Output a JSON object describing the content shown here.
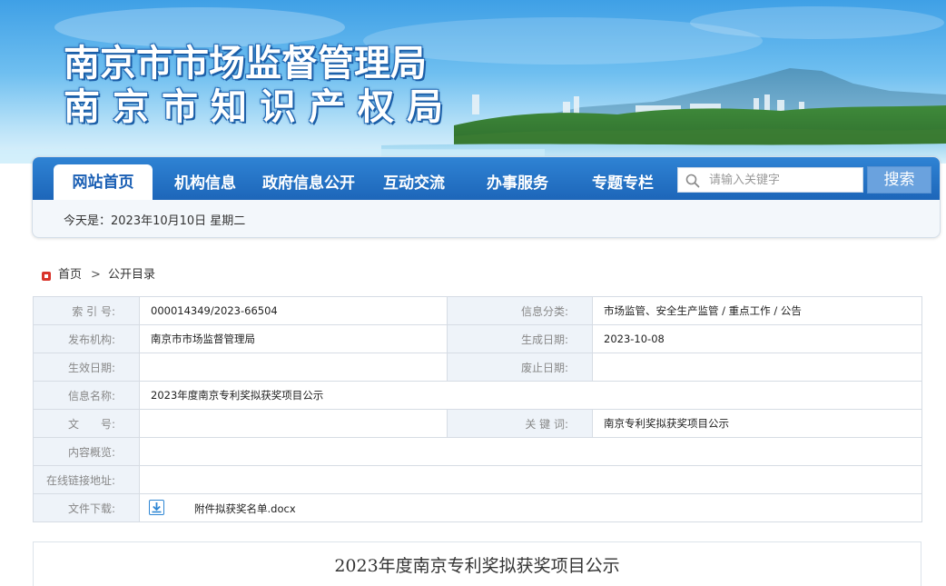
{
  "header": {
    "title_line1": "南京市市场监督管理局",
    "title_line2": "南京市知识产权局"
  },
  "nav": {
    "items": [
      {
        "label": "网站首页",
        "active": true
      },
      {
        "label": "机构信息",
        "active": false
      },
      {
        "label": "政府信息公开",
        "active": false
      },
      {
        "label": "互动交流",
        "active": false
      },
      {
        "label": "办事服务",
        "active": false
      },
      {
        "label": "专题专栏",
        "active": false
      }
    ],
    "search_placeholder": "请输入关键字",
    "search_button": "搜索"
  },
  "date_line": "今天是：2023年10月10日 星期二",
  "breadcrumb": {
    "home": "首页",
    "separator": ">",
    "current": "公开目录"
  },
  "info": {
    "index_label": "索 引 号:",
    "index_value": "000014349/2023-66504",
    "category_label": "信息分类:",
    "category_value": "市场监管、安全生产监管 / 重点工作 / 公告",
    "publisher_label": "发布机构:",
    "publisher_value": "南京市市场监督管理局",
    "created_label": "生成日期:",
    "created_value": "2023-10-08",
    "effective_label": "生效日期:",
    "effective_value": "",
    "abolished_label": "废止日期:",
    "abolished_value": "",
    "name_label": "信息名称:",
    "name_value": "2023年度南京专利奖拟获奖项目公示",
    "docno_label": "文　　号:",
    "docno_value": "",
    "keywords_label": "关 键 词:",
    "keywords_value": "南京专利奖拟获奖项目公示",
    "summary_label": "内容概览:",
    "summary_value": "",
    "link_label": "在线链接地址:",
    "link_value": "",
    "download_label": "文件下载:",
    "download_file": "附件拟获奖名单.docx"
  },
  "article": {
    "title": "2023年度南京专利奖拟获奖项目公示"
  },
  "colors": {
    "nav_blue": "#1d66b9",
    "active_text": "#1a5fb4",
    "label_bg": "#eef3f9",
    "home_icon_red": "#d9342b",
    "search_button": "#6aa2de"
  }
}
